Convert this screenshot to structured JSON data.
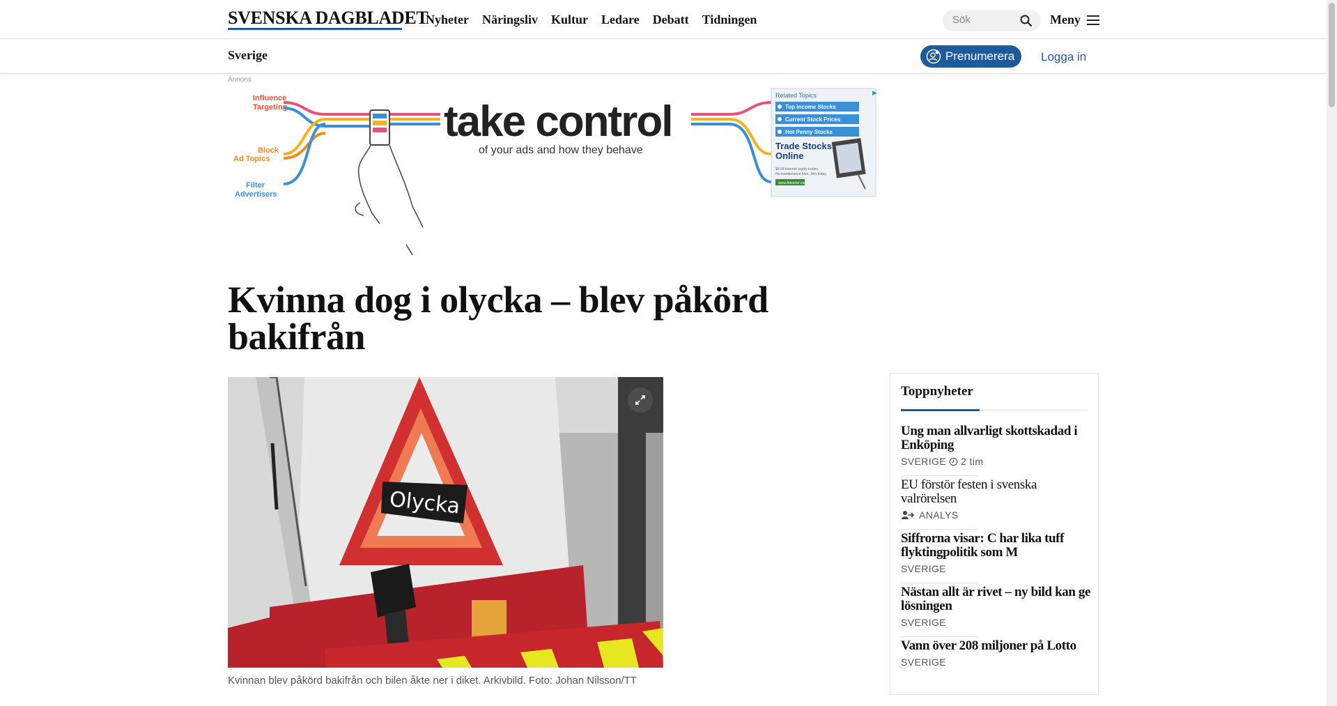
{
  "header": {
    "logo": "SVENSKA DAGBLADET",
    "nav": [
      "Nyheter",
      "Näringsliv",
      "Kultur",
      "Ledare",
      "Debatt",
      "Tidningen"
    ],
    "search_placeholder": "Sök",
    "menu_label": "Meny"
  },
  "subheader": {
    "section": "Sverige",
    "subscribe_label": "Prenumerera",
    "login_label": "Logga in"
  },
  "ad": {
    "label": "Annons",
    "headline": "take control",
    "subline": "of your ads and how they behave",
    "left_items": [
      "Influence",
      "Targeting",
      "Block",
      "Ad Topics",
      "Filter",
      "Advertisers"
    ],
    "related_title": "Related Topics",
    "related_items": [
      "Top Income Stocks",
      "Current Stock Prices",
      "Hot Penny Stocks"
    ],
    "promo_title_1": "Trade Stocks",
    "promo_title_2": "Online",
    "promo_small_1": "$9.99 Internet equity trades.",
    "promo_small_2": "No maintenance fees. Join today.",
    "promo_url": "www.Adverter.com"
  },
  "article": {
    "headline": "Kvinna dog i olycka – blev påkörd bakifrån",
    "image_sign_text": "Olycka",
    "caption": "Kvinnan blev påkörd bakifrån och bilen åkte ner i diket. Arkivbild. Foto: Johan Nilsson/TT"
  },
  "toplist": {
    "title": "Toppnyheter",
    "items": [
      {
        "title": "Ung man allvarligt skottskadad i Enköping",
        "section": "SVERIGE",
        "time": "2 tim"
      },
      {
        "title": "EU förstör festen i svenska valrörelsen",
        "section": "ANALYS"
      },
      {
        "title": "Siffrorna visar: C har lika tuff flyktingpolitik som M",
        "section": "SVERIGE"
      },
      {
        "title": "Nästan allt är rivet – ny bild kan ge lösningen",
        "section": "SVERIGE"
      },
      {
        "title": "Vann över 208 miljoner på Lotto",
        "section": "SVERIGE"
      }
    ]
  },
  "colors": {
    "brand_blue": "#1f5b9b",
    "warning_red": "#c0282d",
    "warning_yellow": "#e5e820"
  }
}
